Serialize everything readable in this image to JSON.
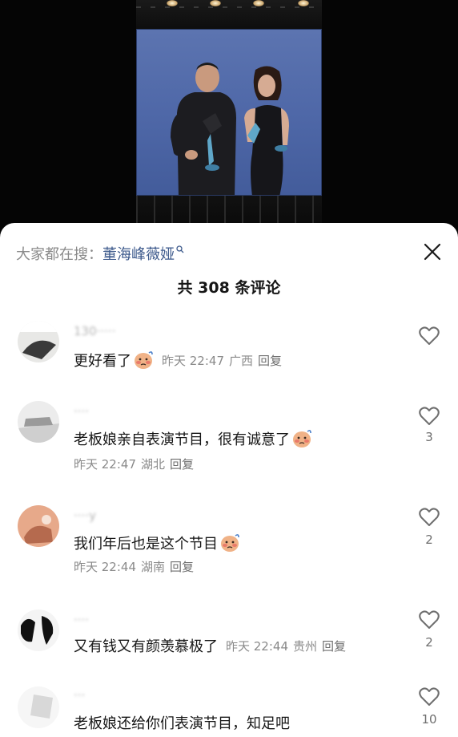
{
  "video": {
    "description_alt": ""
  },
  "sheet": {
    "search_prefix": "大家都在搜：",
    "search_term": "董海峰薇娅",
    "comment_count": "共 308 条评论",
    "close_icon": "close-icon"
  },
  "comments": [
    {
      "username": "130·····",
      "text": "更好看了",
      "emoji": "embarrassed-face-emoji",
      "time": "昨天 22:47",
      "location": "广西",
      "reply": "回复",
      "likes": ""
    },
    {
      "username": "····",
      "text": "老板娘亲自表演节目，很有诚意了",
      "emoji": "embarrassed-face-emoji",
      "time": "昨天 22:47",
      "location": "湖北",
      "reply": "回复",
      "likes": "3"
    },
    {
      "username": "····y",
      "text": "我们年后也是这个节目",
      "emoji": "embarrassed-face-emoji",
      "time": "昨天 22:44",
      "location": "湖南",
      "reply": "回复",
      "likes": "2"
    },
    {
      "username": "····",
      "text": "又有钱又有颜羡慕极了",
      "emoji": "",
      "time": "昨天 22:44",
      "location": "贵州",
      "reply": "回复",
      "likes": "2"
    },
    {
      "username": "···",
      "text": "老板娘还给你们表演节目，知足吧",
      "emoji": "",
      "time": "",
      "location": "",
      "reply": "",
      "likes": "10"
    }
  ],
  "colors": {
    "accent_link": "#3d5a8c",
    "meta_gray": "#8a8a8a",
    "screen_blue": "#4f68a8"
  }
}
